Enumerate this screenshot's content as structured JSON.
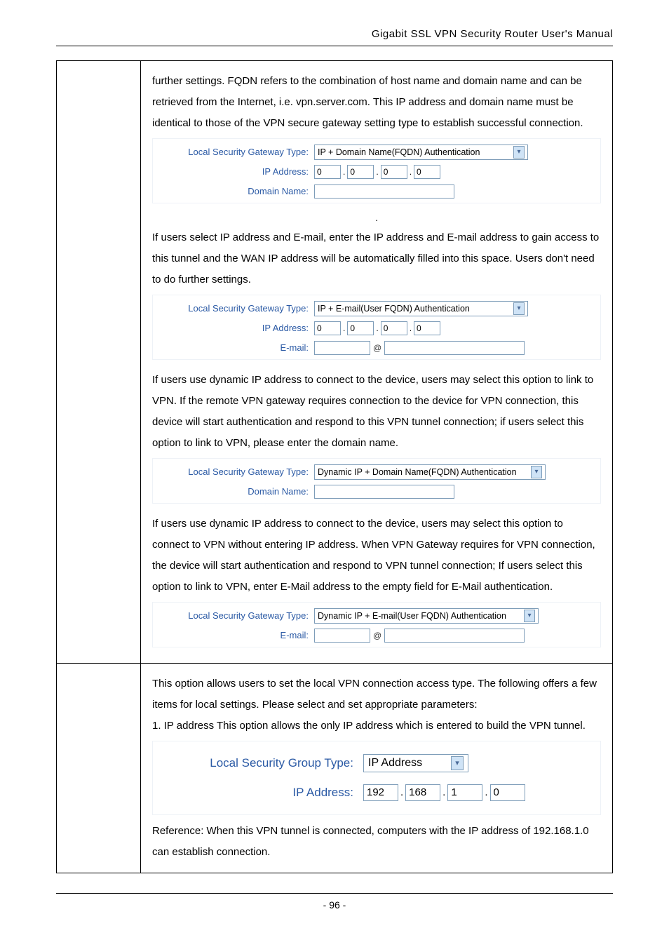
{
  "header": "Gigabit SSL VPN Security Router User's Manual",
  "row1": {
    "p1": "further settings. FQDN refers to the combination of host name and domain name and can be retrieved from the Internet, i.e. vpn.server.com. This IP address and domain name must be identical to those of the VPN secure gateway setting type to establish successful connection.",
    "formA": {
      "typeLabel": "Local Security Gateway Type:",
      "typeValue": "IP + Domain Name(FQDN) Authentication",
      "ipLabel": "IP Address:",
      "ip": [
        "0",
        "0",
        "0",
        "0"
      ],
      "domainLabel": "Domain Name:"
    },
    "p2": "If users select IP address and E-mail, enter the IP address and E-mail address to gain access to this tunnel and the WAN IP address will be automatically filled into this space. Users don't need to do further settings.",
    "formB": {
      "typeLabel": "Local Security Gateway Type:",
      "typeValue": "IP + E-mail(User FQDN) Authentication",
      "ipLabel": "IP Address:",
      "ip": [
        "0",
        "0",
        "0",
        "0"
      ],
      "emailLabel": "E-mail:",
      "at": "@"
    },
    "p3": "If users use dynamic IP address to connect to the device, users may select this option to link to VPN. If the remote VPN gateway requires connection to the device for VPN connection, this device will start authentication and respond to this VPN tunnel connection; if users select this option to link to VPN, please enter the domain name.",
    "formC": {
      "typeLabel": "Local Security Gateway Type:",
      "typeValue": "Dynamic IP + Domain Name(FQDN) Authentication",
      "domainLabel": "Domain Name:"
    },
    "p4": "If users use dynamic IP address to connect to the device, users may select this option to connect to VPN without entering IP address. When VPN Gateway requires for VPN connection, the device will start authentication and respond to VPN tunnel connection; If users select this option to link to VPN, enter E-Mail address to the empty field for E-Mail authentication.",
    "formD": {
      "typeLabel": "Local Security Gateway Type:",
      "typeValue": "Dynamic IP + E-mail(User FQDN) Authentication",
      "emailLabel": "E-mail:",
      "at": "@"
    }
  },
  "row2": {
    "p1": "This option allows users to set the local VPN connection access type. The following offers a few items for local settings. Please select and set appropriate parameters:",
    "p2": "1. IP address This option allows the only IP address which is entered to build the VPN tunnel.",
    "formE": {
      "groupLabel": "Local Security Group Type:",
      "groupValue": "IP Address",
      "ipLabel": "IP Address:",
      "ip": [
        "192",
        "168",
        "1",
        "0"
      ]
    },
    "p3": "Reference: When this VPN tunnel is connected, computers with the IP address of 192.168.1.0 can establish connection."
  },
  "footer": "- 96 -"
}
